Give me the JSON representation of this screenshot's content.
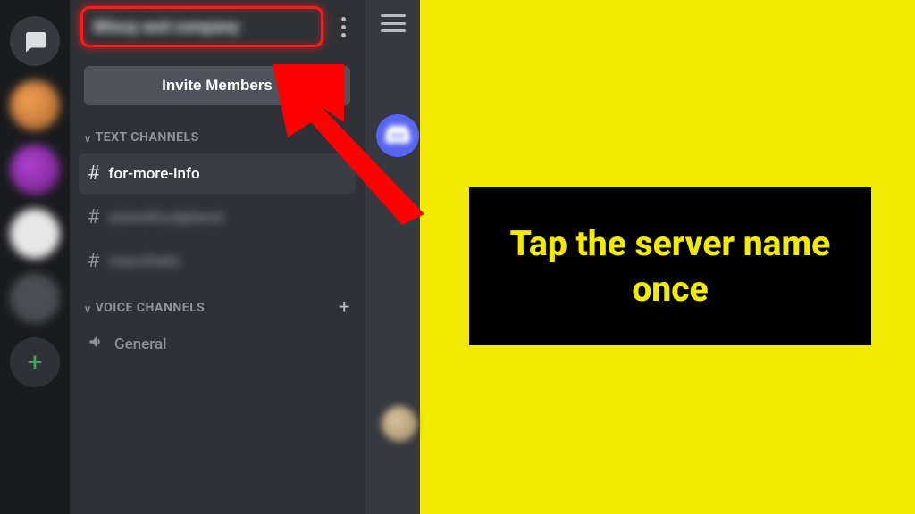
{
  "rail": {
    "add_label": "+"
  },
  "server": {
    "name_blurred": "Bitssy and company"
  },
  "invite_button": "Invite Members",
  "sections": {
    "text_label": "TEXT CHANNELS",
    "voice_label": "VOICE CHANNELS"
  },
  "text_channels": [
    {
      "name": "for-more-info",
      "active": true
    },
    {
      "name": "animefoodplanet",
      "active": false,
      "blurred": true
    },
    {
      "name": "macchiato",
      "active": false,
      "blurred": true
    }
  ],
  "voice_channels": [
    {
      "name": "General"
    }
  ],
  "callout": "Tap the server name once"
}
